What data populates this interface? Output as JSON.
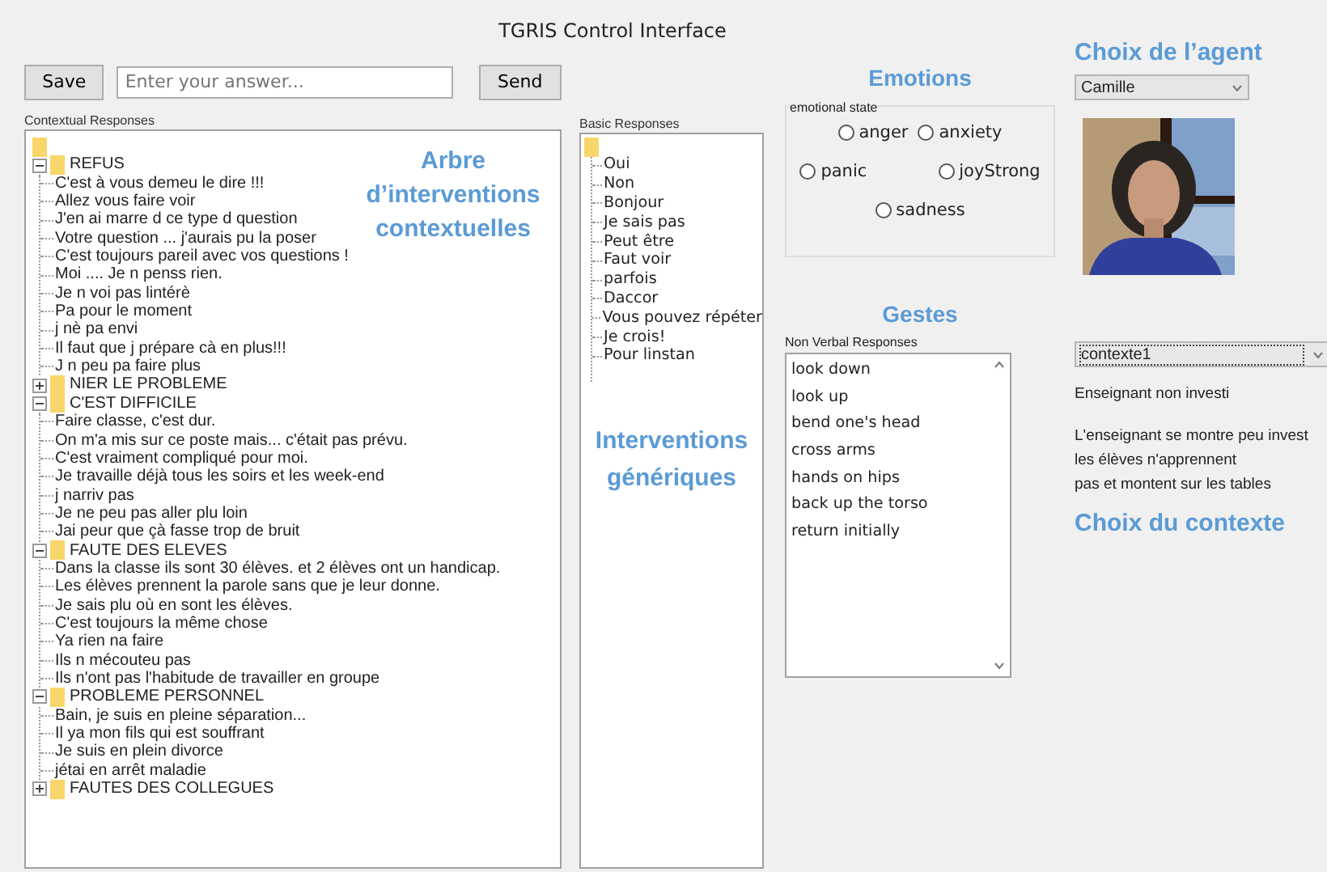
{
  "window": {
    "title": "TGRIS Control Interface"
  },
  "toolbar": {
    "save_button": "Save",
    "answer_field": {
      "placeholder": "Enter your answer..."
    },
    "send_button": "Send"
  },
  "contextual_responses": {
    "label": "Contextual Responses",
    "annotation": "Arbre d’interventions contextuelles",
    "categories": [
      {
        "label": "REFUS",
        "expanded": true,
        "children": [
          "C'est à vous demeu le dire !!!",
          "Allez vous faire voir",
          "J'en ai marre d ce type d question",
          "Votre question ... j'aurais pu la poser",
          "C'est toujours pareil avec vos questions !",
          "Moi .... Je n penss rien.",
          "Je n voi pas lintérè",
          "Pa pour le moment",
          "j nè pa envi",
          "Il faut que j prépare cà en plus!!!",
          "J n peu pa faire plus"
        ]
      },
      {
        "label": "NIER LE PROBLEME",
        "expanded": false
      },
      {
        "label": "C'EST DIFFICILE",
        "expanded": true,
        "children": [
          "Faire classe, c'est dur.",
          "On m'a mis sur ce poste mais... c'était pas prévu.",
          "C'est vraiment compliqué pour moi.",
          "Je travaille déjà tous les soirs et les week-end",
          "j narriv pas",
          "Je ne peu pas aller plu loin",
          "Jai peur que çà fasse trop de bruit"
        ]
      },
      {
        "label": "FAUTE DES ELEVES",
        "expanded": true,
        "children": [
          "Dans la classe ils sont 30 élèves. et 2 élèves ont un handicap.",
          "Les élèves prennent la parole sans que je leur donne.",
          "Je sais plu où en sont les élèves.",
          "C'est toujours la même chose",
          "Ya rien na faire",
          "Ils n mécouteu pas",
          "Ils n'ont pas l'habitude de travailler en groupe"
        ]
      },
      {
        "label": "PROBLEME PERSONNEL",
        "expanded": true,
        "children": [
          "Bain, je suis en pleine séparation...",
          "Il ya mon fils qui est souffrant",
          "Je suis en plein divorce",
          "jétai en arrêt maladie"
        ]
      },
      {
        "label": "FAUTES DES COLLEGUES",
        "expanded": false
      }
    ]
  },
  "basic_responses": {
    "label": "Basic Responses",
    "annotation": "Interventions génériques",
    "items": [
      "Oui",
      "Non",
      "Bonjour",
      "Je sais pas",
      "Peut être",
      "Faut voir",
      "parfois",
      "Daccor",
      "Vous pouvez répéter",
      "Je crois!",
      "Pour linstan"
    ]
  },
  "emotions": {
    "title": "Emotions",
    "group_label": "emotional state",
    "rows": [
      [
        {
          "label": "anger",
          "selected": false
        },
        {
          "label": "anxiety",
          "selected": false
        }
      ],
      [
        {
          "label": "panic",
          "selected": false
        },
        {
          "label": "joyStrong",
          "selected": false
        }
      ],
      [
        {
          "label": "sadness",
          "selected": false
        }
      ]
    ]
  },
  "gestures": {
    "title": "Gestes",
    "label": "Non Verbal Responses",
    "items": [
      "look down",
      "look up",
      "bend one's head",
      "cross arms",
      "hands on hips",
      "back up the torso",
      "return initially"
    ]
  },
  "agent": {
    "title": "Choix de l’agent",
    "selected_agent": "Camille"
  },
  "context": {
    "selected_context": "contexte1",
    "name": "Enseignant non investi",
    "description_lines": [
      "L'enseignant se montre peu invest",
      "les élèves n'apprennent",
      "pas et montent sur les tables"
    ],
    "title": "Choix du contexte"
  }
}
